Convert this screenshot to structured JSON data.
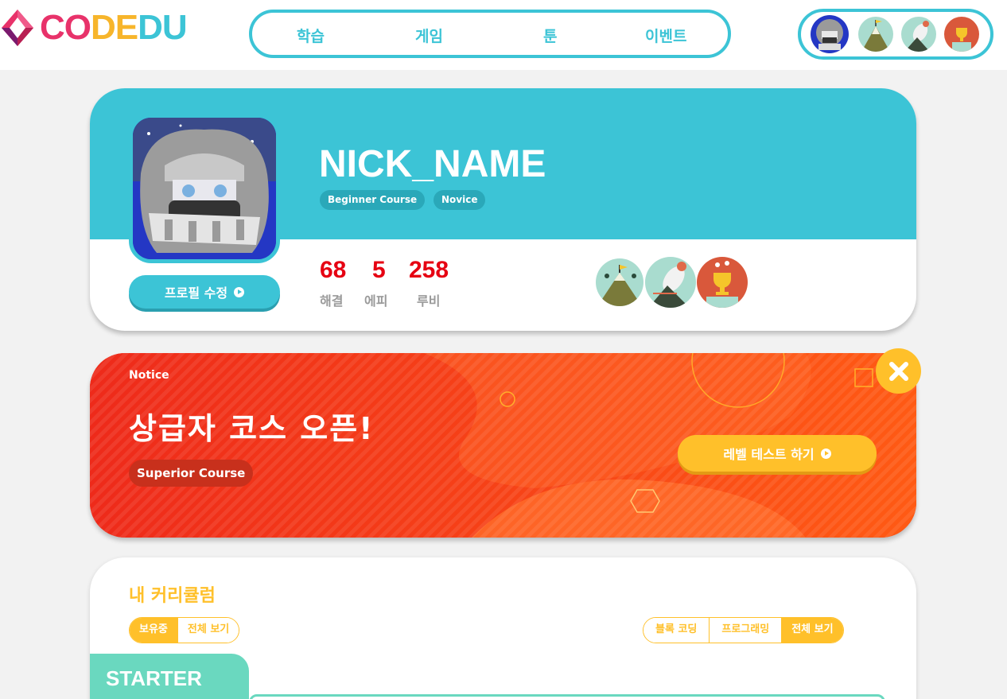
{
  "header": {
    "logo": {
      "part1": "CO",
      "part2": "DE",
      "part3": "DU"
    },
    "nav": [
      {
        "label": "학습"
      },
      {
        "label": "게임"
      },
      {
        "label": "툰"
      },
      {
        "label": "이벤트"
      }
    ],
    "avatars": [
      "profile-avatar",
      "mountain-badge",
      "rocket-badge",
      "trophy-badge"
    ]
  },
  "profile": {
    "nickname": "NICK_NAME",
    "badges": [
      "Beginner Course",
      "Novice"
    ],
    "edit_button": "프로필 수정",
    "stats": [
      {
        "value": "68",
        "label": "해결"
      },
      {
        "value": "5",
        "label": "에피"
      },
      {
        "value": "258",
        "label": "루비"
      }
    ],
    "achievement_icons": [
      "mountain-badge",
      "rocket-badge",
      "trophy-badge"
    ]
  },
  "notice": {
    "label": "Notice",
    "title": "상급자 코스 오픈!",
    "badge": "Superior Course",
    "button": "레벨 테스트 하기"
  },
  "curriculum": {
    "title": "내 커리큘럼",
    "filter_left": [
      "보유중",
      "전체 보기"
    ],
    "filter_right": [
      "블록 코딩",
      "프로그래밍",
      "전체 보기"
    ],
    "section": "STARTER"
  },
  "colors": {
    "primary": "#3cc4d6",
    "accent": "#ffc02a",
    "notice_red": "#f23a1a",
    "stat_red": "#e60012",
    "starter": "#6ad8bf"
  }
}
